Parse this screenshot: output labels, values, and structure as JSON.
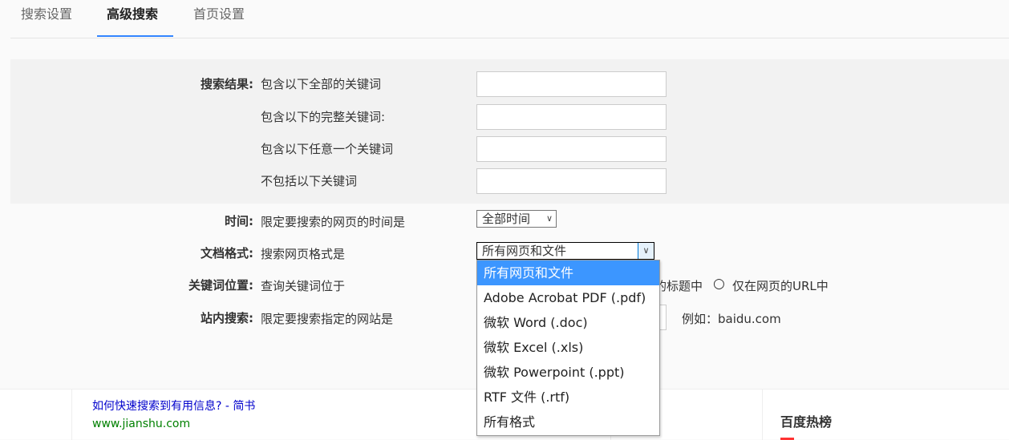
{
  "tabs": [
    "搜索设置",
    "高级搜索",
    "首页设置"
  ],
  "rows": {
    "result_label": "搜索结果:",
    "all_kw": "包含以下全部的关键词",
    "exact_kw": "包含以下的完整关键词:",
    "any_kw": "包含以下任意一个关键词",
    "exclude_kw": "不包括以下关键词",
    "time_label": "时间:",
    "time_desc": "限定要搜索的网页的时间是",
    "time_value": "全部时间",
    "format_label": "文档格式:",
    "format_desc": "搜索网页格式是",
    "format_value": "所有网页和文件",
    "position_label": "关键词位置:",
    "position_desc": "查询关键词位于",
    "position_opt2": "的标题中",
    "position_opt3": "仅在网页的URL中",
    "site_label": "站内搜索:",
    "site_desc": "限定要搜索指定的网站是",
    "site_example": "例如：baidu.com"
  },
  "dropdown_options": [
    "所有网页和文件",
    "Adobe Acrobat PDF (.pdf)",
    "微软 Word (.doc)",
    "微软 Excel (.xls)",
    "微软 Powerpoint (.ppt)",
    "RTF 文件  (.rtf)",
    "所有格式"
  ],
  "bottom": {
    "result_title": "如何快速搜索到有用信息? - 简书",
    "result_url": "www.jianshu.com",
    "hot_title": "百度热榜"
  }
}
